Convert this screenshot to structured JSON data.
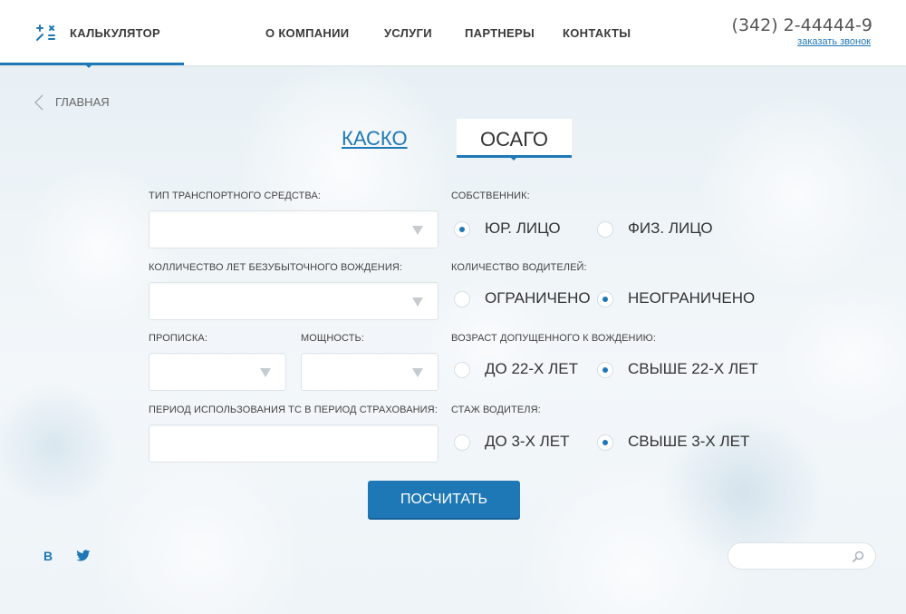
{
  "header": {
    "logo_label": "КАЛЬКУЛЯТОР",
    "nav": [
      {
        "label": "О КОМПАНИИ"
      },
      {
        "label": "УСЛУГИ"
      },
      {
        "label": "ПАРТНЕРЫ"
      },
      {
        "label": "КОНТАКТЫ"
      }
    ],
    "phone": "(342) 2-44444-9",
    "callback": "заказать звонок"
  },
  "breadcrumb": {
    "label": "ГЛАВНАЯ"
  },
  "tabs": [
    {
      "label": "КАСКО",
      "active": false
    },
    {
      "label": "ОСАГО",
      "active": true
    }
  ],
  "form": {
    "vehicle_type_label": "ТИП ТРАНСПОРТНОГО СРЕДСТВА:",
    "claim_free_years_label": "КОЛЛИЧЕСТВО ЛЕТ БЕЗУБЫТОЧНОГО ВОЖДЕНИЯ:",
    "registration_label": "ПРОПИСКА:",
    "power_label": "МОЩНОСТЬ:",
    "usage_period_label": "ПЕРИОД ИСПОЛЬЗОВАНИЯ ТС В ПЕРИОД СТРАХОВАНИЯ:",
    "owner": {
      "label": "СОБСТВЕННИК:",
      "options": [
        {
          "label": "ЮР. ЛИЦО",
          "checked": true
        },
        {
          "label": "ФИЗ. ЛИЦО",
          "checked": false
        }
      ]
    },
    "drivers": {
      "label": "КОЛИЧЕСТВО ВОДИТЕЛЕЙ:",
      "options": [
        {
          "label": "ОГРАНИЧЕНО",
          "checked": false
        },
        {
          "label": "НЕОГРАНИЧЕНО",
          "checked": true
        }
      ]
    },
    "age": {
      "label": "ВОЗРАСТ ДОПУЩЕННОГО К ВОЖДЕНИЮ:",
      "options": [
        {
          "label": "ДО 22-Х ЛЕТ",
          "checked": false
        },
        {
          "label": "СВЫШЕ 22-Х ЛЕТ",
          "checked": true
        }
      ]
    },
    "experience": {
      "label": "СТАЖ ВОДИТЕЛЯ:",
      "options": [
        {
          "label": "ДО 3-Х ЛЕТ",
          "checked": false
        },
        {
          "label": "СВЫШЕ 3-Х ЛЕТ",
          "checked": true
        }
      ]
    },
    "submit_label": "ПОСЧИТАТЬ"
  },
  "footer": {
    "vk_label": "В",
    "search_placeholder": ""
  },
  "colors": {
    "accent": "#1e78b6",
    "text": "#333333"
  }
}
